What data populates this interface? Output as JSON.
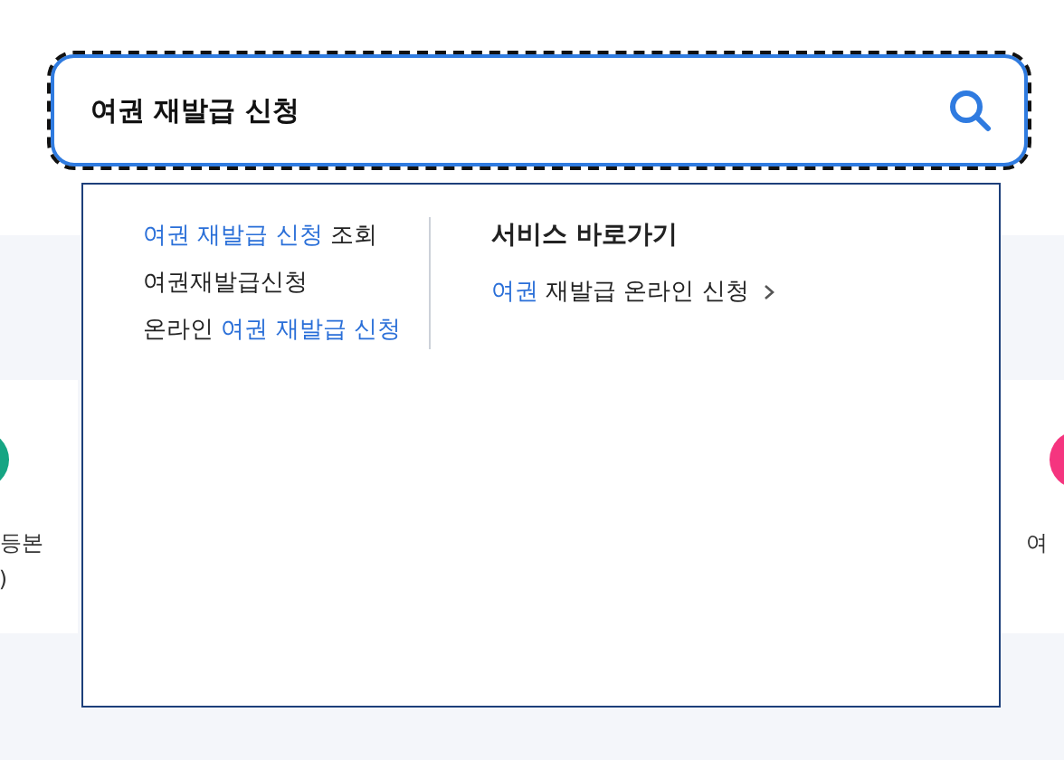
{
  "search": {
    "value": "여권 재발급 신청"
  },
  "suggestions": [
    {
      "parts": [
        {
          "text": "여권 재발급 신청",
          "match": true
        },
        {
          "text": " 조회",
          "match": false
        }
      ]
    },
    {
      "parts": [
        {
          "text": "여권재발급신청",
          "match": false
        }
      ]
    },
    {
      "parts": [
        {
          "text": "온라인 ",
          "match": false
        },
        {
          "text": "여권 재발급 신청",
          "match": true
        }
      ]
    }
  ],
  "shortcuts": {
    "title": "서비스 바로가기",
    "links": [
      {
        "parts": [
          {
            "text": "여권",
            "match": true
          },
          {
            "text": " 재발급 온라인 신청",
            "match": false
          }
        ]
      }
    ]
  },
  "service_cards": [
    {
      "kind": "left",
      "color": "#16a583",
      "lines": [
        "등본",
        ")"
      ]
    },
    {
      "kind": "right",
      "color": "#f5357f",
      "lines": [
        "여"
      ]
    }
  ]
}
